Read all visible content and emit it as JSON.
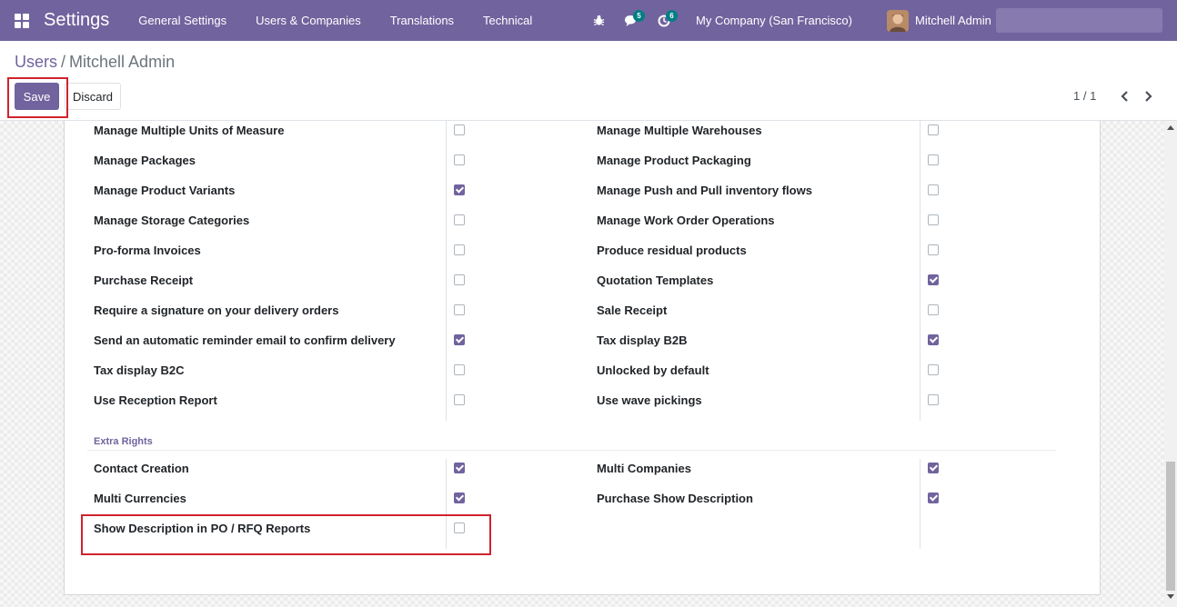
{
  "navbar": {
    "app_title": "Settings",
    "menu": [
      "General Settings",
      "Users & Companies",
      "Translations",
      "Technical"
    ],
    "messages_count": "5",
    "activities_count": "6",
    "company": "My Company (San Francisco)",
    "user_name": "Mitchell Admin"
  },
  "breadcrumb": {
    "parent": "Users",
    "separator": "/",
    "current": "Mitchell Admin"
  },
  "actions": {
    "save_label": "Save",
    "discard_label": "Discard"
  },
  "pager": {
    "value": "1 / 1"
  },
  "rights": [
    {
      "left": {
        "label": "Manage Multiple Units of Measure",
        "checked": false
      },
      "right": {
        "label": "Manage Multiple Warehouses",
        "checked": false
      }
    },
    {
      "left": {
        "label": "Manage Packages",
        "checked": false
      },
      "right": {
        "label": "Manage Product Packaging",
        "checked": false
      }
    },
    {
      "left": {
        "label": "Manage Product Variants",
        "checked": true
      },
      "right": {
        "label": "Manage Push and Pull inventory flows",
        "checked": false
      }
    },
    {
      "left": {
        "label": "Manage Storage Categories",
        "checked": false
      },
      "right": {
        "label": "Manage Work Order Operations",
        "checked": false
      }
    },
    {
      "left": {
        "label": "Pro-forma Invoices",
        "checked": false
      },
      "right": {
        "label": "Produce residual products",
        "checked": false
      }
    },
    {
      "left": {
        "label": "Purchase Receipt",
        "checked": false
      },
      "right": {
        "label": "Quotation Templates",
        "checked": true
      }
    },
    {
      "left": {
        "label": "Require a signature on your delivery orders",
        "checked": false
      },
      "right": {
        "label": "Sale Receipt",
        "checked": false
      }
    },
    {
      "left": {
        "label": "Send an automatic reminder email to confirm delivery",
        "checked": true
      },
      "right": {
        "label": "Tax display B2B",
        "checked": true
      }
    },
    {
      "left": {
        "label": "Tax display B2C",
        "checked": false
      },
      "right": {
        "label": "Unlocked by default",
        "checked": false
      }
    },
    {
      "left": {
        "label": "Use Reception Report",
        "checked": false
      },
      "right": {
        "label": "Use wave pickings",
        "checked": false
      }
    }
  ],
  "extra_rights": {
    "title": "Extra Rights",
    "rows": [
      {
        "left": {
          "label": "Contact Creation",
          "checked": true
        },
        "right": {
          "label": "Multi Companies",
          "checked": true
        }
      },
      {
        "left": {
          "label": "Multi Currencies",
          "checked": true
        },
        "right": {
          "label": "Purchase Show Description",
          "checked": true
        }
      },
      {
        "left": {
          "label": "Show Description in PO / RFQ Reports",
          "checked": false
        },
        "right": null
      }
    ]
  },
  "colors": {
    "brand": "#71639e",
    "badge": "#017e84",
    "highlight": "#d0232d"
  }
}
